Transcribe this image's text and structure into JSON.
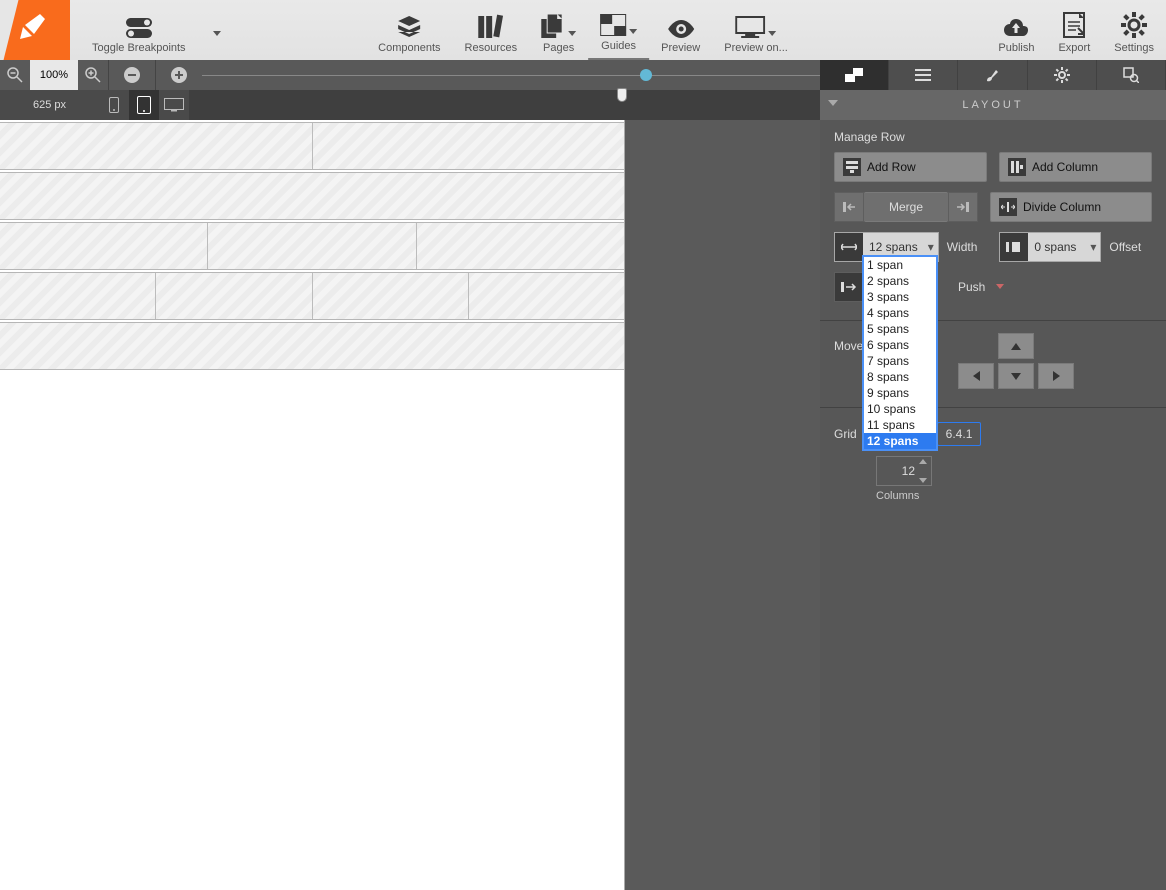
{
  "topbar": {
    "toggle_breakpoints": "Toggle Breakpoints",
    "components": "Components",
    "resources": "Resources",
    "pages": "Pages",
    "guides": "Guides",
    "preview": "Preview",
    "preview_on": "Preview on...",
    "publish": "Publish",
    "export": "Export",
    "settings": "Settings"
  },
  "zoom": {
    "zoom_value": "100%"
  },
  "pxbar": {
    "width_value": "625 px"
  },
  "layout": {
    "header": "LAYOUT",
    "manage_row": "Manage Row",
    "add_row": "Add Row",
    "add_column": "Add Column",
    "merge": "Merge",
    "divide_column": "Divide Column",
    "width_combo": "12 spans",
    "width_label": "Width",
    "offset_combo": "0 spans",
    "offset_label": "Offset",
    "push_label": "Push",
    "move_label": "Move",
    "grid_label": "Grid",
    "grid_version": "6.4.1",
    "columns_value": "12",
    "columns_label": "Columns"
  },
  "span_options": [
    "1 span",
    "2 spans",
    "3 spans",
    "4 spans",
    "5 spans",
    "6 spans",
    "7 spans",
    "8 spans",
    "9 spans",
    "10 spans",
    "11 spans",
    "12 spans"
  ],
  "span_selected": "12 spans",
  "canvas_rows": [
    [
      6,
      6
    ],
    [
      12
    ],
    [
      4,
      4,
      4
    ],
    [
      3,
      3,
      3,
      3
    ],
    [
      12
    ]
  ]
}
